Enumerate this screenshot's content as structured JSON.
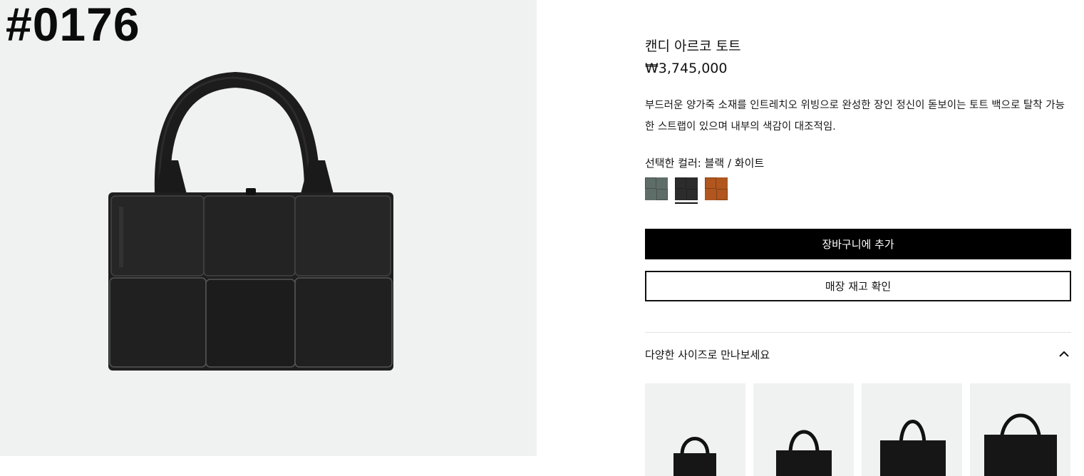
{
  "overlay": {
    "id_label": "#0176"
  },
  "product": {
    "title": "캔디 아르코 토트",
    "price": "₩3,745,000",
    "description": "부드러운 양가죽 소재를 인트레치오 위빙으로 완성한 장인 정신이 돋보이는 토트 백으로 탈착 가능한 스트랩이 있으며 내부의 색감이 대조적임.",
    "selected_color_label": "선택한 컬러: 블랙 / 화이트",
    "swatches": [
      {
        "name": "grey-green",
        "color": "#5f6d69"
      },
      {
        "name": "black",
        "color": "#2c2c2c",
        "selected": true
      },
      {
        "name": "brown",
        "color": "#b0561e"
      }
    ]
  },
  "actions": {
    "add_to_cart": "장바구니에 추가",
    "check_store_stock": "매장 재고 확인"
  },
  "sizes_section": {
    "heading": "다양한 사이즈로 만나보세요",
    "toggle_icon": "chevron-up-icon",
    "thumbnails": [
      "size-1",
      "size-2",
      "size-3",
      "size-4"
    ]
  },
  "colors": {
    "image_background": "#f0f2f1",
    "bag_leather": "#1f1f1f",
    "primary_button": "#000000"
  }
}
